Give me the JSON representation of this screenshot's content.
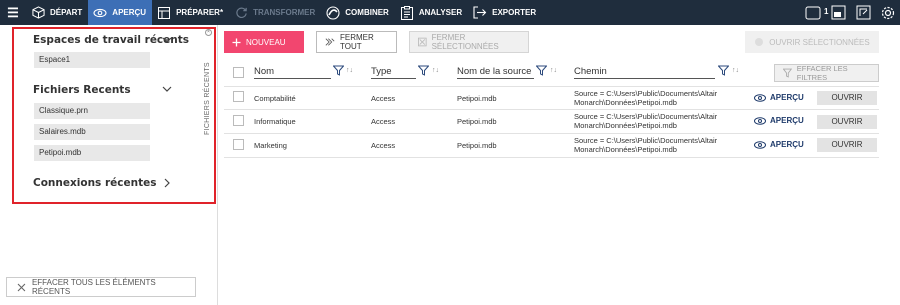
{
  "toolbar": {
    "items": [
      {
        "label": "DÉPART",
        "icon": "cube-icon"
      },
      {
        "label": "APERÇU",
        "icon": "eye-icon",
        "active": true
      },
      {
        "label": "PRÉPARER*",
        "icon": "table-icon"
      },
      {
        "label": "TRANSFORMER",
        "icon": "refresh-icon",
        "disabled": true
      },
      {
        "label": "COMBINER",
        "icon": "combine-icon"
      },
      {
        "label": "ANALYSER",
        "icon": "clipboard-icon"
      },
      {
        "label": "EXPORTER",
        "icon": "export-icon"
      }
    ],
    "badge": "1"
  },
  "sidebar": {
    "workspaces_title": "Espaces de travail récents",
    "workspaces": [
      "Espace1"
    ],
    "files_title": "Fichiers Recents",
    "files": [
      "Classique.prn",
      "Salaires.mdb",
      "Petipoi.mdb"
    ],
    "connections_title": "Connexions récentes",
    "vertical_tab": "FICHIERS RÉCENTS",
    "clear_all": "EFFACER TOUS LES ÉLÉMENTS RÉCENTS"
  },
  "actions": {
    "new": "NOUVEAU",
    "close_all": "FERMER TOUT",
    "close_selected": "FERMER SÉLECTIONNÉES",
    "open_selected": "OUVRIR SÉLECTIONNÉES",
    "clear_filters": "EFFACER LES FILTRES"
  },
  "table": {
    "columns": [
      "Nom",
      "Type",
      "Nom de la source",
      "Chemin"
    ],
    "rows": [
      {
        "name": "Comptabilité",
        "type": "Access",
        "source": "Petipoi.mdb",
        "path1": "Source = C:\\Users\\Public\\Documents\\Altair",
        "path2": "Monarch\\Données\\Petipoi.mdb"
      },
      {
        "name": "Informatique",
        "type": "Access",
        "source": "Petipoi.mdb",
        "path1": "Source = C:\\Users\\Public\\Documents\\Altair",
        "path2": "Monarch\\Données\\Petipoi.mdb"
      },
      {
        "name": "Marketing",
        "type": "Access",
        "source": "Petipoi.mdb",
        "path1": "Source = C:\\Users\\Public\\Documents\\Altair",
        "path2": "Monarch\\Données\\Petipoi.mdb"
      }
    ],
    "preview_label": "APERÇU",
    "open_label": "OUVRIR"
  }
}
